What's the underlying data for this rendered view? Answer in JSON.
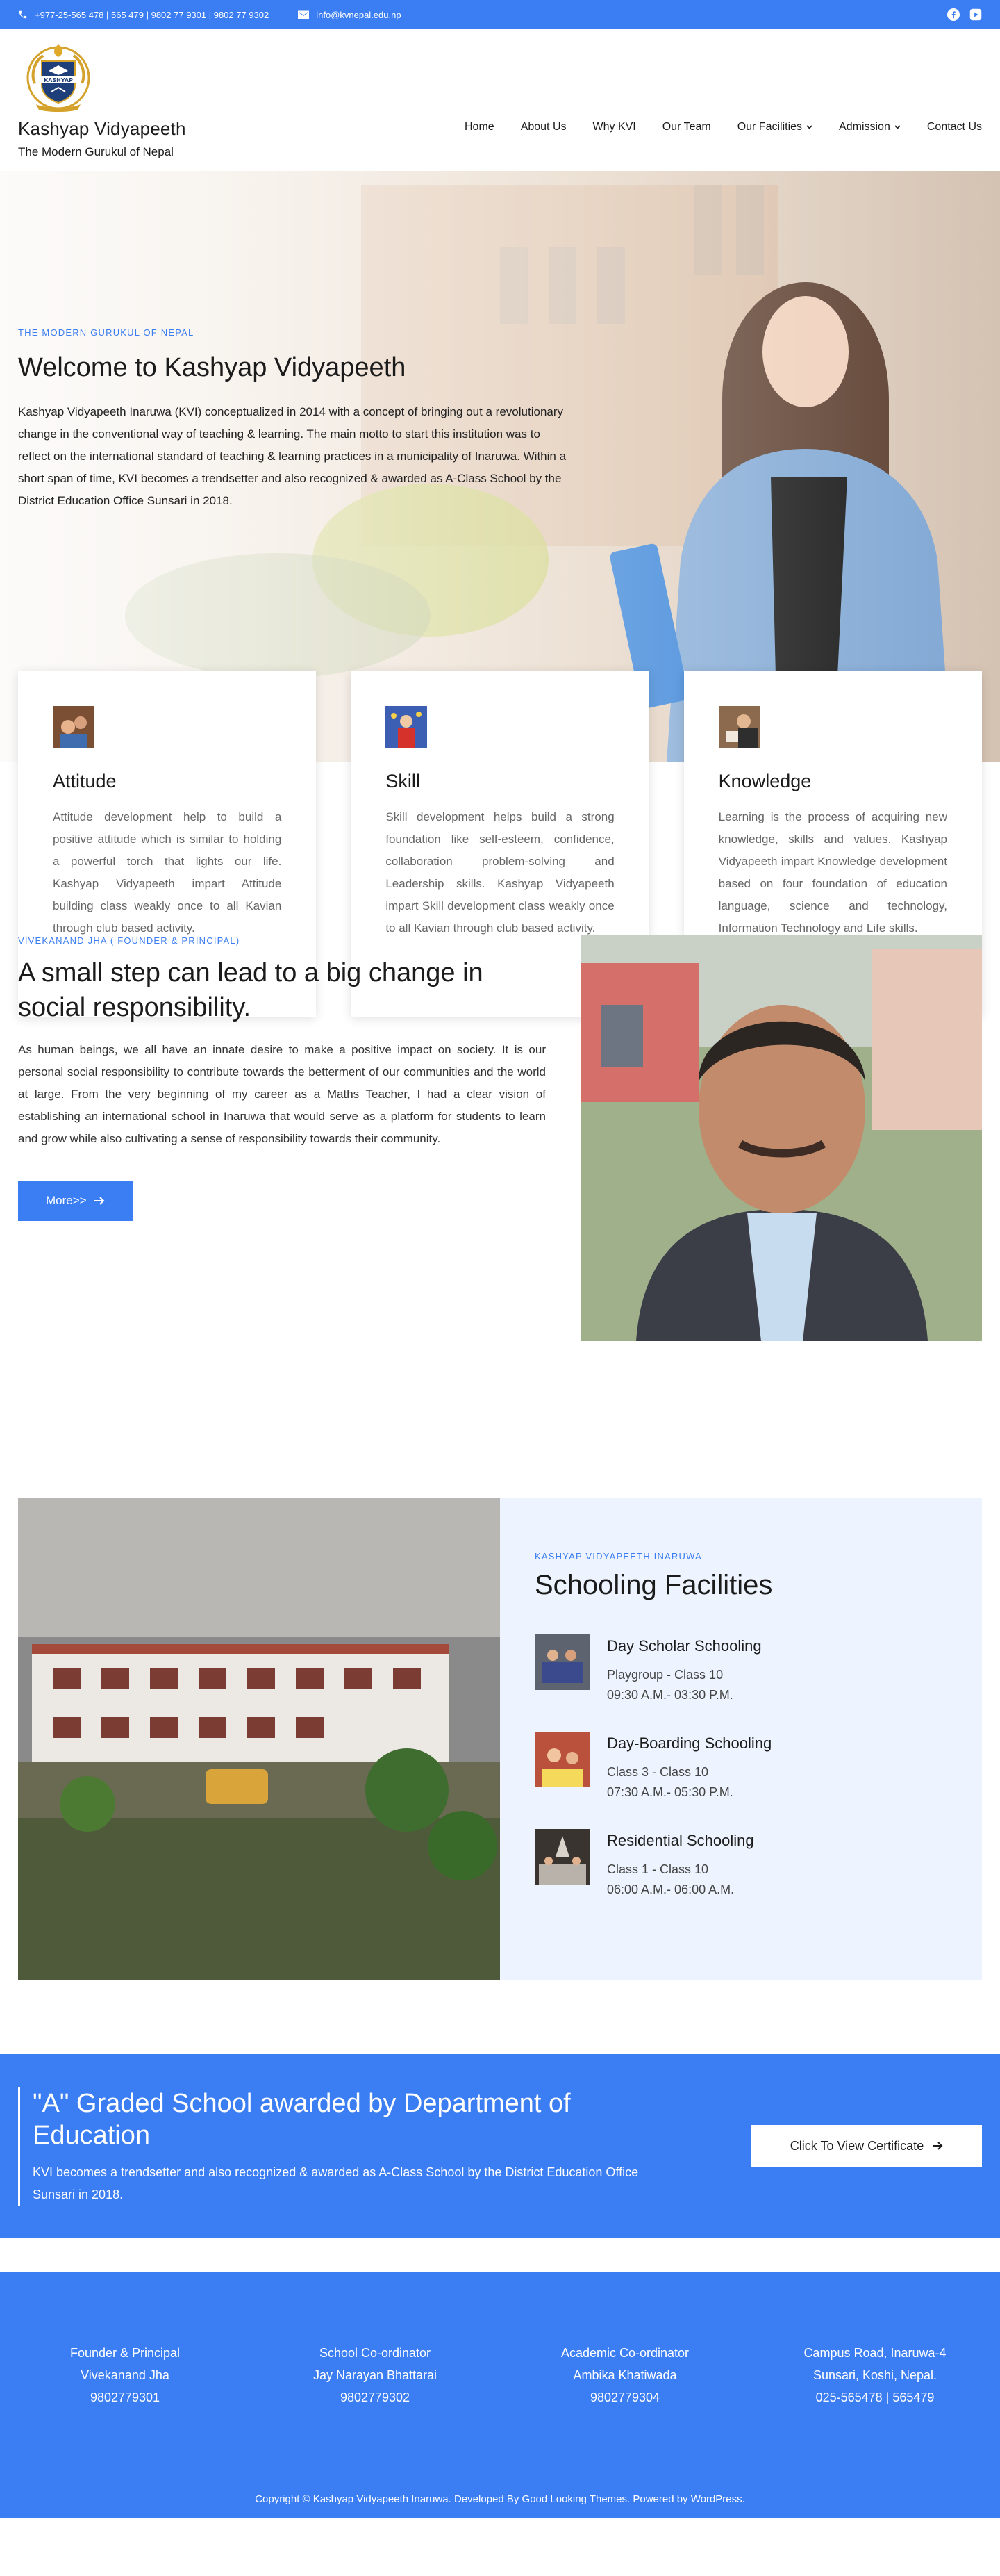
{
  "topbar": {
    "phone": "+977-25-565 478 | 565 479 | 9802 77 9301 | 9802 77 9302",
    "email": "info@kvnepal.edu.np",
    "social": [
      "facebook-icon",
      "youtube-icon"
    ]
  },
  "header": {
    "name": "Kashyap Vidyapeeth",
    "tagline": "The Modern Gurukul of Nepal",
    "logo_text": "KASHYAP",
    "nav": [
      {
        "label": "Home"
      },
      {
        "label": "About Us"
      },
      {
        "label": "Why KVI"
      },
      {
        "label": "Our Team"
      },
      {
        "label": "Our Facilities"
      },
      {
        "label": "Admission"
      },
      {
        "label": "Contact Us"
      }
    ]
  },
  "hero": {
    "eyebrow": "THE MODERN GURUKUL OF NEPAL",
    "title": "Welcome to Kashyap Vidyapeeth",
    "description": "Kashyap Vidyapeeth Inaruwa (KVI) conceptualized in 2014 with a concept of bringing out a revolutionary change in the conventional way of teaching & learning. The main motto to start this institution was to reflect on the international standard of teaching & learning practices in a municipality of Inaruwa. Within a short span of time, KVI becomes a trendsetter and also recognized & awarded as A-Class School by the District Education Office Sunsari in 2018."
  },
  "cards": [
    {
      "title": "Attitude",
      "text": "Attitude development help to build a positive attitude which is similar to holding a powerful torch that lights our life. Kashyap Vidyapeeth impart Attitude building class weakly once to all Kavian through club based activity."
    },
    {
      "title": "Skill",
      "text": "Skill development helps build a strong foundation like self-esteem, confidence, collaboration problem-solving and Leadership skills. Kashyap Vidyapeeth impart Skill development class weakly once to all Kavian through club based activity."
    },
    {
      "title": "Knowledge",
      "text": "Learning is the process of acquiring new knowledge, skills and values. Kashyap Vidyapeeth impart Knowledge development based on four foundation of education language, science and technology, Information Technology and Life skills."
    }
  ],
  "founder": {
    "eyebrow": "VIVEKANAND JHA ( FOUNDER & PRINCIPAL)",
    "title": "A small step can lead to a big change in social responsibility.",
    "text": "As human beings, we all have an innate desire to make a positive impact on society. It is our personal social responsibility to contribute towards the betterment of our communities and the world at large. From the very beginning of my career as a Maths Teacher, I had a clear vision of establishing an international school in Inaruwa that would serve as a platform for students to learn and grow while also cultivating a sense of responsibility towards their community.",
    "button": "More>>"
  },
  "schooling": {
    "eyebrow": "KASHYAP VIDYAPEETH INARUWA",
    "title": "Schooling Facilities",
    "items": [
      {
        "title": "Day Scholar Schooling",
        "classes": "Playgroup - Class 10",
        "time": "09:30 A.M.- 03:30 P.M."
      },
      {
        "title": "Day-Boarding Schooling",
        "classes": "Class 3 - Class 10",
        "time": "07:30 A.M.- 05:30 P.M."
      },
      {
        "title": "Residential Schooling",
        "classes": "Class 1 - Class 10",
        "time": "06:00 A.M.- 06:00 A.M."
      }
    ]
  },
  "award": {
    "title": "\"A\" Graded School awarded by Department of Education",
    "text": "KVI becomes a trendsetter and also recognized & awarded as A-Class School by the District Education Office Sunsari in 2018.",
    "button": "Click To View Certificate"
  },
  "footer": {
    "columns": [
      {
        "role": "Founder & Principal",
        "name": "Vivekanand Jha",
        "contact": "9802779301"
      },
      {
        "role": "School Co-ordinator",
        "name": "Jay Narayan Bhattarai",
        "contact": "9802779302"
      },
      {
        "role": "Academic Co-ordinator",
        "name": "Ambika Khatiwada",
        "contact": "9802779304"
      },
      {
        "role": "Campus Road, Inaruwa-4",
        "name": "Sunsari, Koshi, Nepal.",
        "contact": "025-565478 | 565479"
      }
    ],
    "copyright": "Copyright © Kashyap Vidyapeeth Inaruwa. Developed By Good Looking Themes. Powered by WordPress."
  },
  "colors": {
    "accent": "#3b7df2",
    "panel": "#eef4ff"
  }
}
